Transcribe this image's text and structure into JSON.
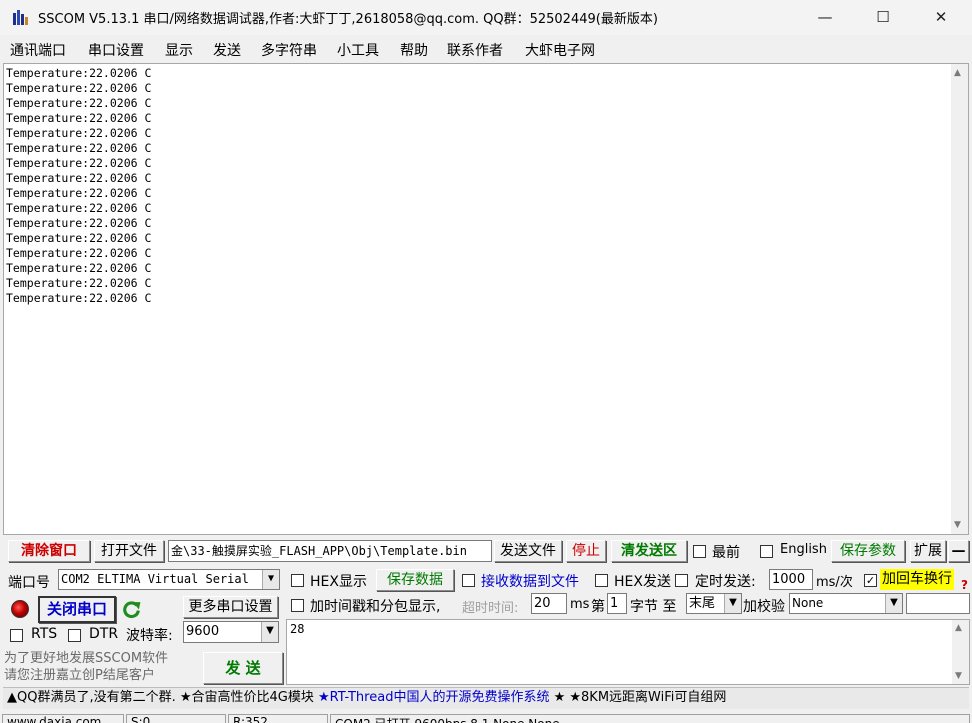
{
  "window": {
    "title": "SSCOM V5.13.1 串口/网络数据调试器,作者:大虾丁丁,2618058@qq.com. QQ群：52502449(最新版本)",
    "minimize": "—",
    "maximize": "☐",
    "close": "✕"
  },
  "menu": [
    "通讯端口",
    "串口设置",
    "显示",
    "发送",
    "多字符串",
    "小工具",
    "帮助",
    "联系作者",
    "大虾电子网"
  ],
  "output": {
    "lines": [
      "Temperature:22.0206 C",
      "Temperature:22.0206 C",
      "Temperature:22.0206 C",
      "Temperature:22.0206 C",
      "Temperature:22.0206 C",
      "Temperature:22.0206 C",
      "Temperature:22.0206 C",
      "Temperature:22.0206 C",
      "Temperature:22.0206 C",
      "Temperature:22.0206 C",
      "Temperature:22.0206 C",
      "Temperature:22.0206 C",
      "Temperature:22.0206 C",
      "Temperature:22.0206 C",
      "Temperature:22.0206 C",
      "Temperature:22.0206 C"
    ]
  },
  "toolbar": {
    "clear_window": "清除窗口",
    "open_file": "打开文件",
    "file_path": "金\\33-触摸屏实验_FLASH_APP\\Obj\\Template.bin",
    "send_file": "发送文件",
    "stop": "停止",
    "clear_send_area": "清发送区",
    "topmost": "最前",
    "english": "English",
    "save_params": "保存参数",
    "expand": "扩展",
    "collapse": "—"
  },
  "port": {
    "port_label": "端口号",
    "port_value": "COM2 ELTIMA Virtual Serial",
    "close_port": "关闭串口",
    "more_settings": "更多串口设置",
    "rts": "RTS",
    "dtr": "DTR",
    "baud_label": "波特率:",
    "baud_value": "9600"
  },
  "options": {
    "hex_display": "HEX显示",
    "save_data": "保存数据",
    "receive_to_file": "接收数据到文件",
    "hex_send": "HEX发送",
    "timed_send": "定时发送:",
    "timed_value": "1000",
    "ms_per": "ms/次",
    "append_newline": "加回车换行",
    "timestamp_split": "加时间戳和分包显示,",
    "timeout_label": "超时时间:",
    "timeout_value": "20",
    "ms": "ms",
    "index_label": "第",
    "index_value": "1",
    "byte_label": "字节 至",
    "end_value": "末尾",
    "checksum_label": "加校验",
    "checksum_value": "None",
    "help": "?"
  },
  "send": {
    "text": "28",
    "promo": "为了更好地发展SSCOM软件\n请您注册嘉立创P结尾客户",
    "send_button": "发 送"
  },
  "promo_bar": {
    "part1": "▲QQ群满员了,没有第二个群. ★合宙高性价比4G模块 ",
    "part2": "★RT-Thread中国人的开源免费操作系统",
    "part3": " ★ ★8KM远距离WiFi可自组网"
  },
  "status": {
    "site": "www.daxia.com",
    "s": "S:0",
    "r": "R:352",
    "port_state": "COM2 已打开  9600bps,8,1,None,None"
  },
  "colors": {
    "red_text": "#cc0000",
    "green_text": "#007a00",
    "blue_text": "#0000cc",
    "highlight_yellow": "#ffff00"
  }
}
